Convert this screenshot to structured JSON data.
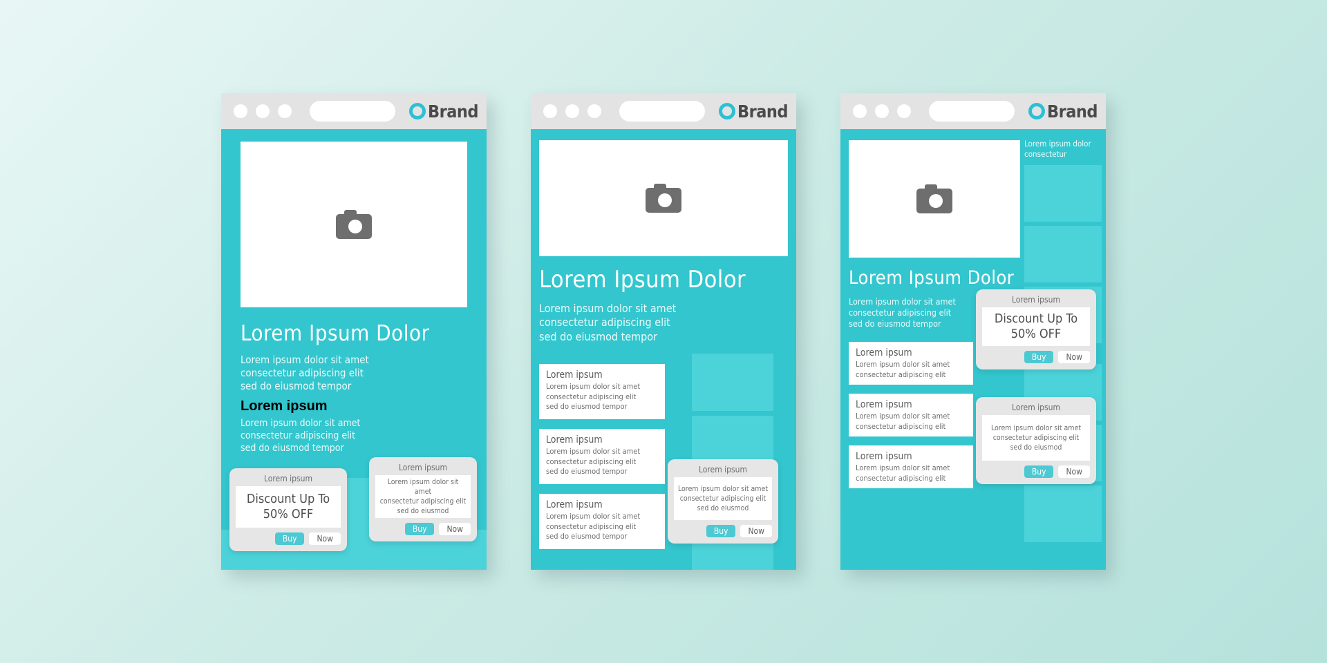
{
  "background": {
    "gradient_from": "#e8f7f5",
    "gradient_to": "#b6e2dc"
  },
  "theme": {
    "teal": "#33c6ce",
    "teal_light": "#4bd3d9",
    "chrome_gray": "#e3e3e3",
    "card_gray": "#e6e6e6",
    "icon_gray": "#6e6e6e",
    "accent_button": "#4cc9d2"
  },
  "browser": {
    "brand_label": "Brand",
    "dots": [
      "dot-1",
      "dot-2",
      "dot-3"
    ],
    "url_placeholder": "",
    "logo_icon": "ring-logo-icon"
  },
  "common": {
    "heading": "Lorem Ipsum Dolor",
    "paragraph_line1": "Lorem ipsum dolor sit amet",
    "paragraph_line2": "consectetur adipiscing elit",
    "paragraph_line3": "sed do eiusmod tempor",
    "card_title": "Lorem ipsum",
    "photo_icon": "camera-icon",
    "promo_caption": "Lorem ipsum",
    "discount_line1": "Discount Up To",
    "discount_line2": "50% OFF",
    "promo_body_line1": "Lorem ipsum dolor sit amet",
    "promo_body_line2": "consectetur adipiscing elit",
    "promo_body_line3": "sed do eiusmod",
    "buy_label": "Buy",
    "now_label": "Now",
    "sidebar_line1": "Lorem ipsum dolor",
    "sidebar_line2": "consectetur"
  },
  "panel1": {
    "heading": "Lorem Ipsum Dolor",
    "para1_line1": "Lorem ipsum dolor sit amet",
    "para1_line2": "consectetur adipiscing elit",
    "para1_line3": "sed do eiusmod tempor",
    "subheading": "Lorem ipsum",
    "para2_line1": "Lorem ipsum dolor sit amet",
    "para2_line2": "consectetur adipiscing elit",
    "para2_line3": "sed do eiusmod tempor"
  },
  "panel2": {
    "heading": "Lorem Ipsum Dolor",
    "para_line1": "Lorem ipsum dolor sit amet",
    "para_line2": "consectetur adipiscing elit",
    "para_line3": "sed do eiusmod tempor",
    "cards": [
      {
        "title": "Lorem ipsum",
        "line1": "Lorem ipsum dolor sit amet",
        "line2": "consectetur adipiscing elit",
        "line3": "sed do eiusmod tempor"
      },
      {
        "title": "Lorem ipsum",
        "line1": "Lorem ipsum dolor sit amet",
        "line2": "consectetur adipiscing elit",
        "line3": "sed do eiusmod tempor"
      },
      {
        "title": "Lorem ipsum",
        "line1": "Lorem ipsum dolor sit amet",
        "line2": "consectetur adipiscing elit",
        "line3": "sed do eiusmod tempor"
      }
    ]
  },
  "panel3": {
    "heading": "Lorem Ipsum Dolor",
    "para_line1": "Lorem ipsum dolor sit amet",
    "para_line2": "consectetur adipiscing elit",
    "para_line3": "sed do eiusmod tempor",
    "sidebar_line1": "Lorem ipsum dolor",
    "sidebar_line2": "consectetur",
    "cards": [
      {
        "title": "Lorem ipsum",
        "line1": "Lorem ipsum dolor sit amet",
        "line2": "consectetur adipiscing elit"
      },
      {
        "title": "Lorem ipsum",
        "line1": "Lorem ipsum dolor sit amet",
        "line2": "consectetur adipiscing elit"
      },
      {
        "title": "Lorem ipsum",
        "line1": "Lorem ipsum dolor sit amet",
        "line2": "consectetur adipiscing elit"
      }
    ]
  }
}
